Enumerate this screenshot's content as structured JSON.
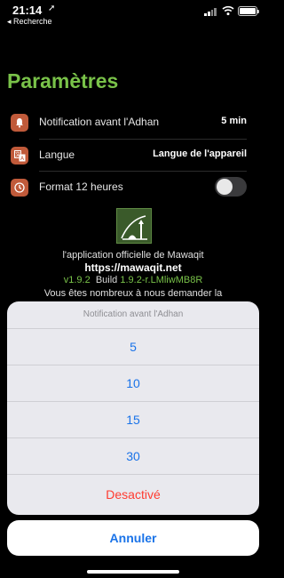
{
  "status_bar": {
    "time": "21:14",
    "back_label": "◂ Recherche"
  },
  "page_title": "Paramètres",
  "settings": {
    "notification": {
      "label": "Notification avant l'Adhan",
      "value": "5 min",
      "icon": "bell-icon"
    },
    "language": {
      "label": "Langue",
      "value": "Langue de l'appareil",
      "icon": "translate-icon"
    },
    "format": {
      "label": "Format 12 heures",
      "icon": "clock-icon",
      "toggle_on": false
    }
  },
  "about": {
    "description": "l'application officielle de Mawaqit",
    "url": "https://mawaqit.net",
    "version": "v1.9.2",
    "build_label": "Build",
    "build": "1.9.2-r.LMliwMB8R",
    "truncated_text": "Vous êtes nombreux à nous demander la"
  },
  "sheet": {
    "title": "Notification avant l'Adhan",
    "options": [
      "5",
      "10",
      "15",
      "30"
    ],
    "disable_label": "Desactivé",
    "cancel_label": "Annuler"
  },
  "colors": {
    "accent_green": "#79c249",
    "icon_bg": "#c05a3a",
    "ios_blue": "#1a73e8",
    "destructive": "#ff3b30"
  }
}
